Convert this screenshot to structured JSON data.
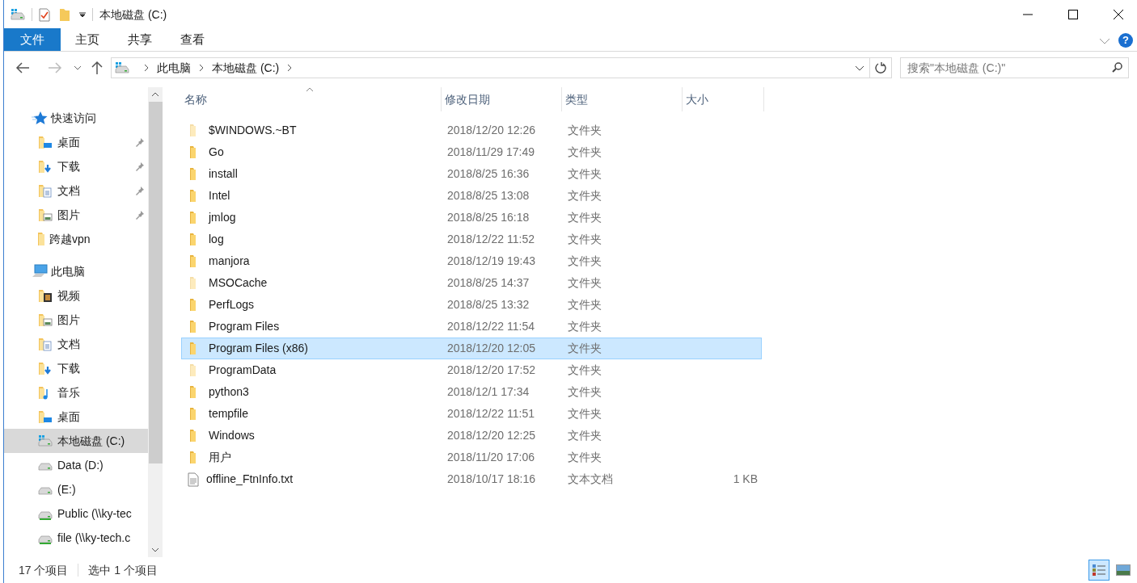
{
  "window": {
    "title": "本地磁盘 (C:)"
  },
  "ribbon_tabs": [
    {
      "label": "文件",
      "kind": "file"
    },
    {
      "label": "主页",
      "kind": "tab"
    },
    {
      "label": "共享",
      "kind": "tab"
    },
    {
      "label": "查看",
      "kind": "tab"
    }
  ],
  "address_bar": {
    "path": [
      "此电脑",
      "本地磁盘 (C:)"
    ]
  },
  "help": {
    "icon": "?"
  },
  "search": {
    "placeholder": "搜索\"本地磁盘 (C:)\""
  },
  "navigation": [
    {
      "label": "快速访问",
      "kind": "star",
      "selected": false,
      "children": [
        {
          "label": "桌面",
          "kind": "desktop",
          "pinned": true,
          "selected": false
        },
        {
          "label": "下载",
          "kind": "download",
          "pinned": true,
          "selected": false
        },
        {
          "label": "文档",
          "kind": "document",
          "pinned": true,
          "selected": false
        },
        {
          "label": "图片",
          "kind": "picture",
          "pinned": true,
          "selected": false
        },
        {
          "label": "跨越vpn",
          "kind": "folder",
          "pinned": false,
          "selected": false
        }
      ]
    },
    {
      "label": "此电脑",
      "kind": "computer",
      "selected": false,
      "children": [
        {
          "label": "视频",
          "kind": "video",
          "pinned": false,
          "selected": false
        },
        {
          "label": "图片",
          "kind": "picture",
          "pinned": false,
          "selected": false
        },
        {
          "label": "文档",
          "kind": "document",
          "pinned": false,
          "selected": false
        },
        {
          "label": "下载",
          "kind": "download",
          "pinned": false,
          "selected": false
        },
        {
          "label": "音乐",
          "kind": "music",
          "pinned": false,
          "selected": false
        },
        {
          "label": "桌面",
          "kind": "desktop",
          "pinned": false,
          "selected": false
        },
        {
          "label": "本地磁盘 (C:)",
          "kind": "system-drive",
          "pinned": false,
          "selected": true
        },
        {
          "label": "Data (D:)",
          "kind": "drive",
          "pinned": false,
          "selected": false
        },
        {
          "label": " (E:)",
          "kind": "drive",
          "pinned": false,
          "selected": false
        },
        {
          "label": "Public (\\\\ky-tec",
          "kind": "network-drive",
          "pinned": false,
          "selected": false
        },
        {
          "label": "file (\\\\ky-tech.c",
          "kind": "network-drive",
          "pinned": false,
          "selected": false
        }
      ]
    }
  ],
  "table": {
    "columns": [
      "名称",
      "修改日期",
      "类型",
      "大小"
    ],
    "rows": [
      {
        "name": "$WINDOWS.~BT",
        "date": "2018/12/20 12:26",
        "type": "文件夹",
        "kind": "folder",
        "hidden": true,
        "selected": false
      },
      {
        "name": "Go",
        "date": "2018/11/29 17:49",
        "type": "文件夹",
        "kind": "folder",
        "hidden": false,
        "selected": false
      },
      {
        "name": "install",
        "date": "2018/8/25 16:36",
        "type": "文件夹",
        "kind": "folder",
        "hidden": false,
        "selected": false
      },
      {
        "name": "Intel",
        "date": "2018/8/25 13:08",
        "type": "文件夹",
        "kind": "folder",
        "hidden": false,
        "selected": false
      },
      {
        "name": "jmlog",
        "date": "2018/8/25 16:18",
        "type": "文件夹",
        "kind": "folder",
        "hidden": false,
        "selected": false
      },
      {
        "name": "log",
        "date": "2018/12/22 11:52",
        "type": "文件夹",
        "kind": "folder",
        "hidden": false,
        "selected": false
      },
      {
        "name": "manjora",
        "date": "2018/12/19 19:43",
        "type": "文件夹",
        "kind": "folder",
        "hidden": false,
        "selected": false
      },
      {
        "name": "MSOCache",
        "date": "2018/8/25 14:37",
        "type": "文件夹",
        "kind": "folder",
        "hidden": true,
        "selected": false
      },
      {
        "name": "PerfLogs",
        "date": "2018/8/25 13:32",
        "type": "文件夹",
        "kind": "folder",
        "hidden": false,
        "selected": false
      },
      {
        "name": "Program Files",
        "date": "2018/12/22 11:54",
        "type": "文件夹",
        "kind": "folder",
        "hidden": false,
        "selected": false
      },
      {
        "name": "Program Files (x86)",
        "date": "2018/12/20 12:05",
        "type": "文件夹",
        "kind": "folder",
        "hidden": false,
        "selected": true
      },
      {
        "name": "ProgramData",
        "date": "2018/12/20 17:52",
        "type": "文件夹",
        "kind": "folder",
        "hidden": true,
        "selected": false
      },
      {
        "name": "python3",
        "date": "2018/12/1 17:34",
        "type": "文件夹",
        "kind": "folder",
        "hidden": false,
        "selected": false
      },
      {
        "name": "tempfile",
        "date": "2018/12/22 11:51",
        "type": "文件夹",
        "kind": "folder",
        "hidden": false,
        "selected": false
      },
      {
        "name": "Windows",
        "date": "2018/12/20 12:25",
        "type": "文件夹",
        "kind": "folder",
        "hidden": false,
        "selected": false
      },
      {
        "name": "用户",
        "date": "2018/11/20 17:06",
        "type": "文件夹",
        "kind": "folder",
        "hidden": false,
        "selected": false
      },
      {
        "name": "offline_FtnInfo.txt",
        "date": "2018/10/17 18:16",
        "type": "文本文档",
        "size": "1 KB",
        "kind": "text-file",
        "hidden": false,
        "selected": false
      }
    ]
  },
  "status_bar": {
    "item_count": "17 个项目",
    "selection": "选中 1 个项目"
  },
  "view_buttons": [
    {
      "kind": "details",
      "selected": true
    },
    {
      "kind": "large-icons",
      "selected": false
    }
  ]
}
